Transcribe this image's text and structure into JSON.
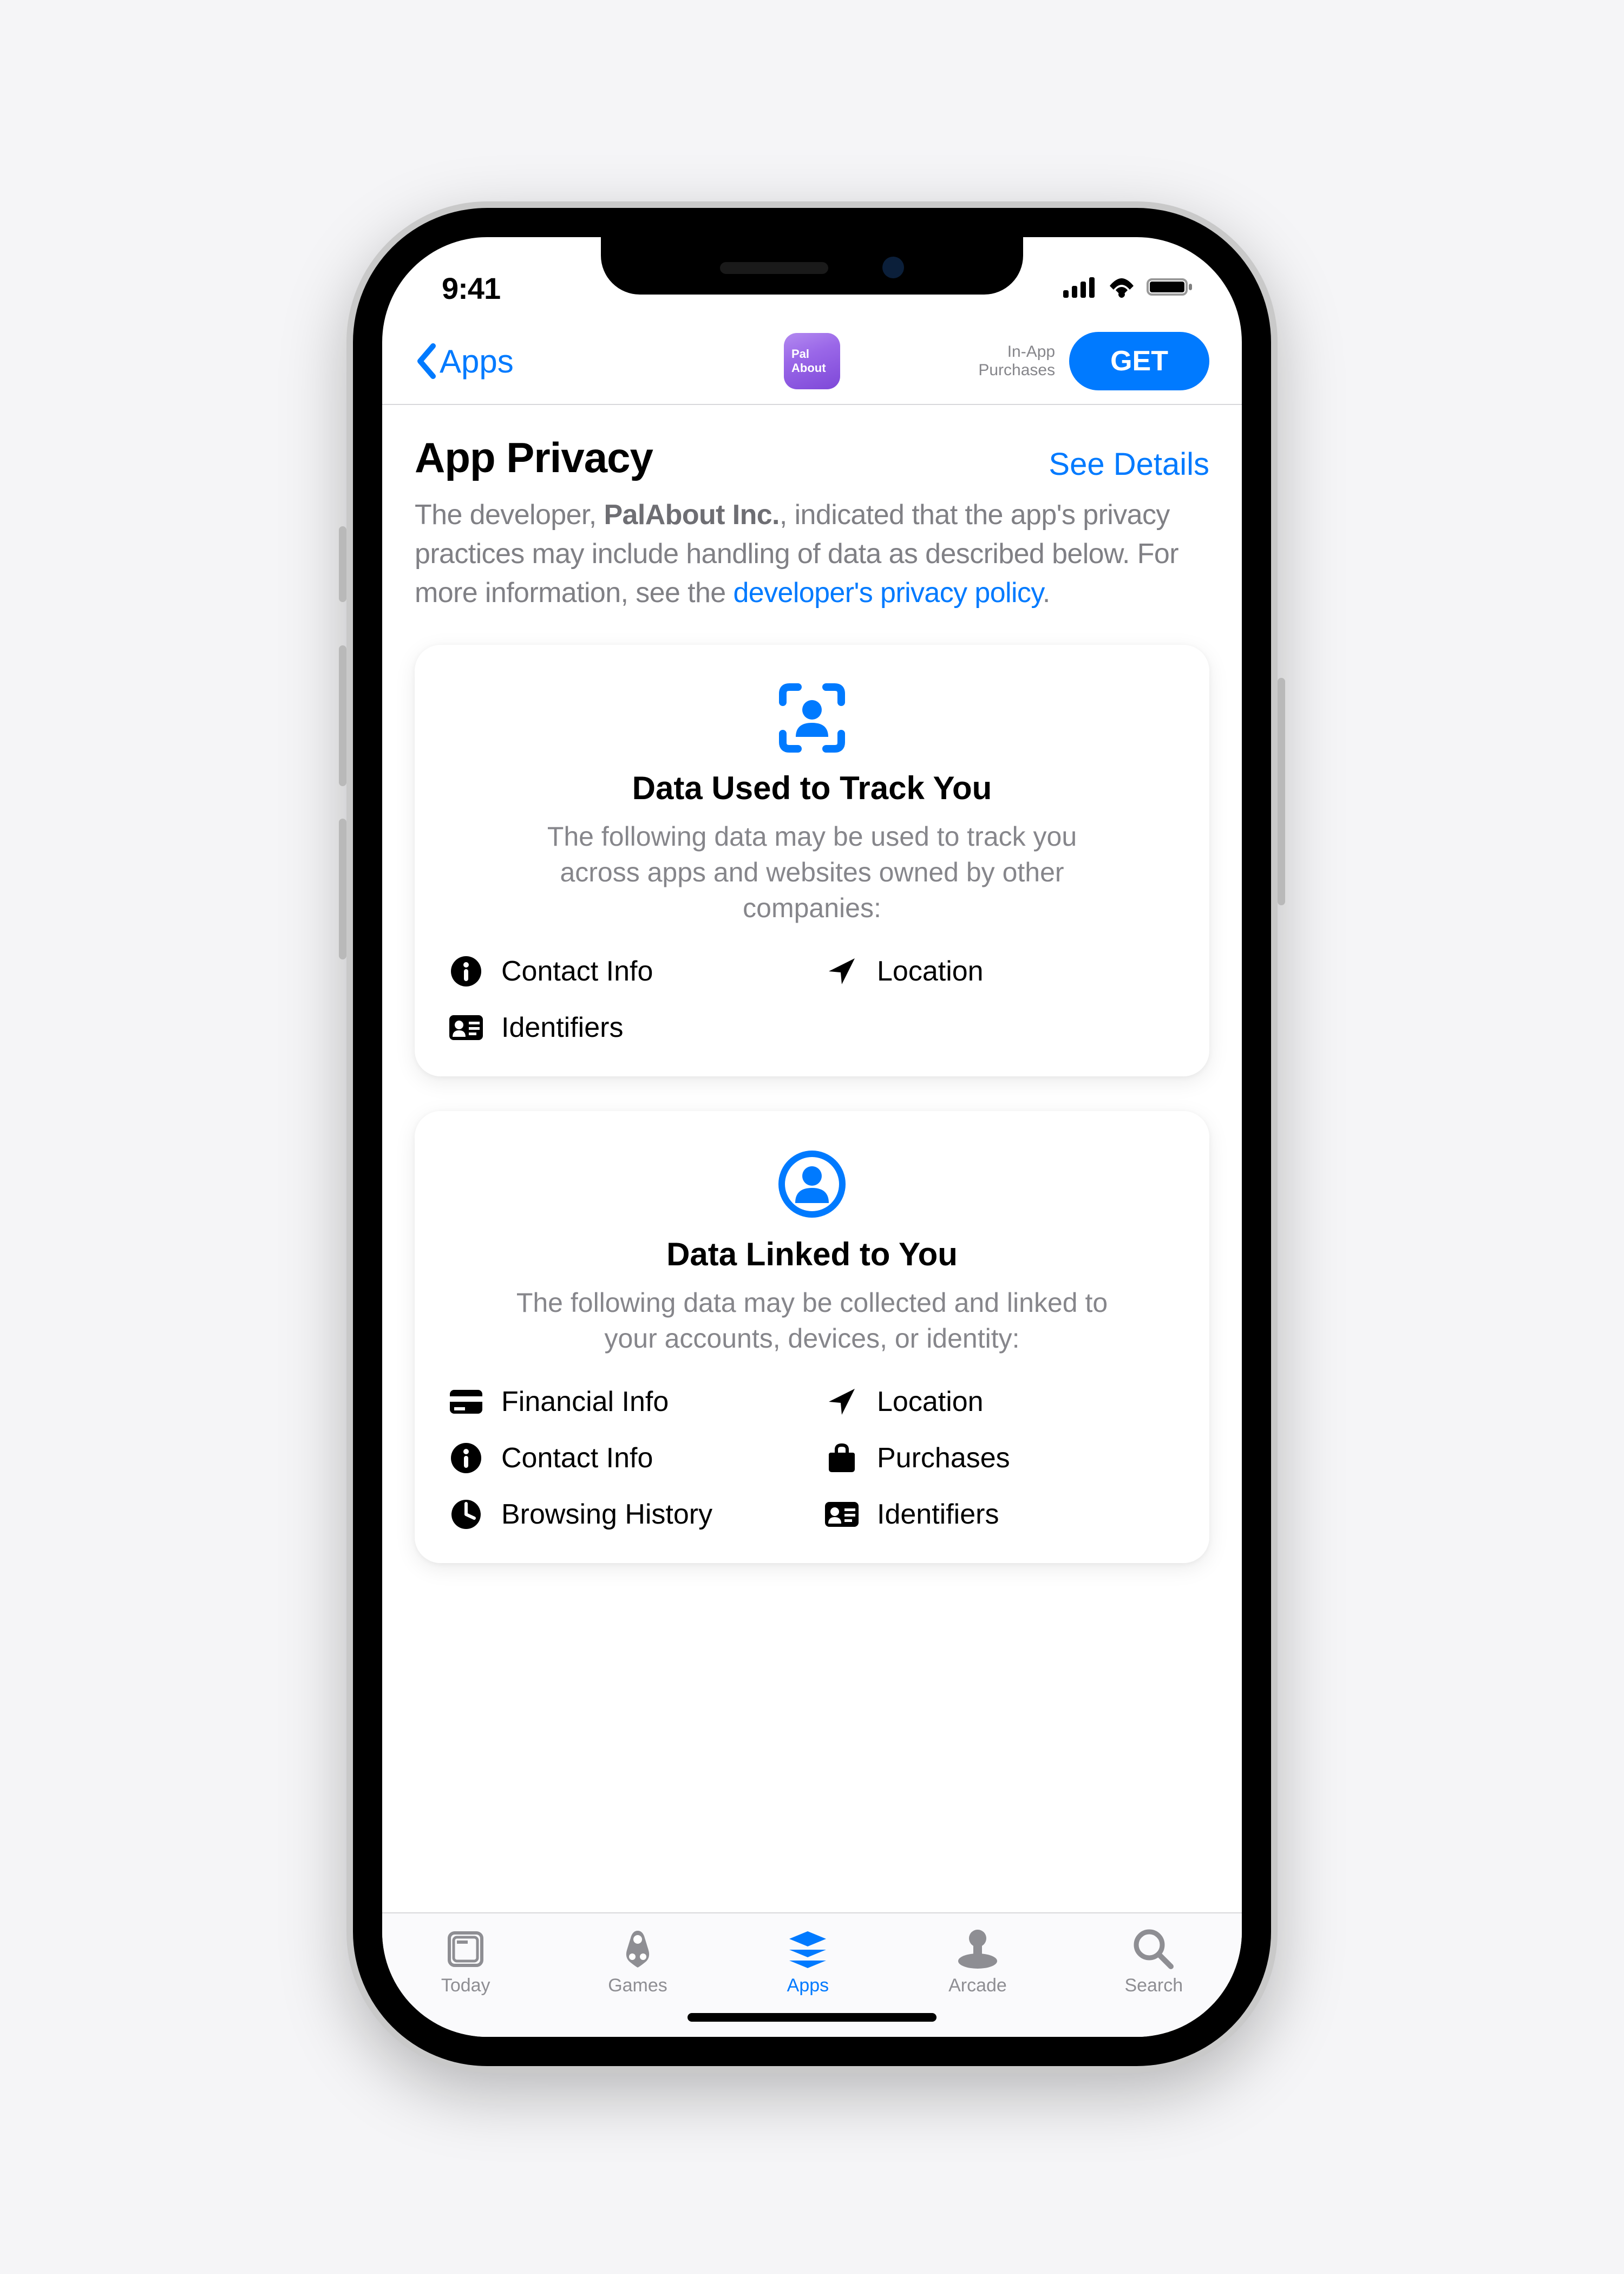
{
  "statusbar": {
    "time": "9:41"
  },
  "nav": {
    "back_label": "Apps",
    "app_icon_line1": "Pal",
    "app_icon_line2": "About",
    "iap_line1": "In-App",
    "iap_line2": "Purchases",
    "get_label": "GET"
  },
  "page": {
    "title": "App Privacy",
    "see_details": "See Details",
    "intro_before": "The developer, ",
    "developer_name": "PalAbout Inc.",
    "intro_mid": ", indicated that the app's privacy practices may include handling of data as described below. For more information, see the ",
    "intro_link": "developer's privacy policy",
    "intro_after": "."
  },
  "cards": [
    {
      "icon": "track",
      "title": "Data Used to Track You",
      "desc": "The following data may be used to track you across apps and websites owned by other companies:",
      "items": [
        {
          "icon": "contact",
          "label": "Contact Info"
        },
        {
          "icon": "location",
          "label": "Location"
        },
        {
          "icon": "identifiers",
          "label": "Identifiers"
        }
      ]
    },
    {
      "icon": "linked",
      "title": "Data Linked to You",
      "desc": "The following data may be collected and linked to your accounts, devices, or identity:",
      "items": [
        {
          "icon": "financial",
          "label": "Financial Info"
        },
        {
          "icon": "location",
          "label": "Location"
        },
        {
          "icon": "contact",
          "label": "Contact Info"
        },
        {
          "icon": "purchases",
          "label": "Purchases"
        },
        {
          "icon": "browsing",
          "label": "Browsing History"
        },
        {
          "icon": "identifiers",
          "label": "Identifiers"
        }
      ]
    }
  ],
  "tabs": [
    {
      "icon": "today",
      "label": "Today",
      "active": false
    },
    {
      "icon": "games",
      "label": "Games",
      "active": false
    },
    {
      "icon": "apps",
      "label": "Apps",
      "active": true
    },
    {
      "icon": "arcade",
      "label": "Arcade",
      "active": false
    },
    {
      "icon": "search",
      "label": "Search",
      "active": false
    }
  ]
}
